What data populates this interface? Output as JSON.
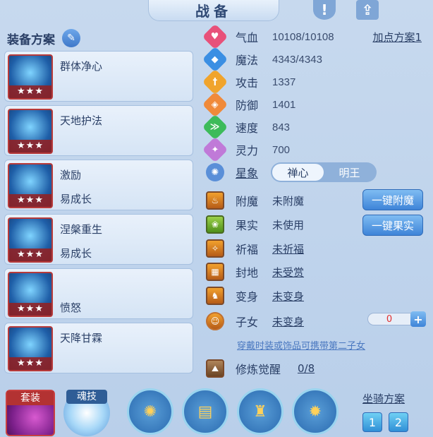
{
  "title": "战备",
  "left": {
    "plan_header": "装备方案",
    "plans": [
      {
        "name": "群体净心",
        "sub": "",
        "stars": "★★★"
      },
      {
        "name": "天地护法",
        "sub": "",
        "stars": "★★★"
      },
      {
        "name": "激励",
        "sub": "易成长",
        "stars": "★★★"
      },
      {
        "name": "涅槃重生",
        "sub": "易成长",
        "stars": "★★★"
      },
      {
        "name": "",
        "sub": "愤怒",
        "stars": "★★★"
      },
      {
        "name": "天降甘霖",
        "sub": "",
        "stars": "★★★"
      }
    ]
  },
  "stats": {
    "add_point_plan": "加点方案1",
    "rows": [
      {
        "label": "气血",
        "value": "10108/10108",
        "icon": "heart-icon",
        "color": "#e8517a"
      },
      {
        "label": "魔法",
        "value": "4343/4343",
        "icon": "mana-icon",
        "color": "#3b8fe3"
      },
      {
        "label": "攻击",
        "value": "1337",
        "icon": "sword-icon",
        "color": "#f0a42c"
      },
      {
        "label": "防御",
        "value": "1401",
        "icon": "shield-icon",
        "color": "#f08a3a"
      },
      {
        "label": "速度",
        "value": "843",
        "icon": "speed-icon",
        "color": "#3dbb5a"
      },
      {
        "label": "灵力",
        "value": "700",
        "icon": "spirit-icon",
        "color": "#c07ad8"
      }
    ],
    "star_label": "星象",
    "toggle": {
      "options": [
        "禅心",
        "明王"
      ],
      "selected": "禅心"
    }
  },
  "props": [
    {
      "label": "附魔",
      "value": "未附魔",
      "underline": false
    },
    {
      "label": "果实",
      "value": "未使用",
      "underline": false
    },
    {
      "label": "祈福",
      "value": "未祈福",
      "underline": true
    },
    {
      "label": "封地",
      "value": "未受赏",
      "underline": true
    },
    {
      "label": "变身",
      "value": "未变身",
      "underline": true
    },
    {
      "label": "子女",
      "value": "未变身",
      "underline": true
    }
  ],
  "buttons": {
    "enchant": "一键附魔",
    "fruit": "一键果实"
  },
  "child_count": "0",
  "hint": "穿戴时装或饰品可携带第二子女",
  "cultivation": {
    "label": "修炼觉醒",
    "value": "0/8"
  },
  "bottom": {
    "skin_tab": "套装",
    "soul_tab": "魂技",
    "mount_title": "坐骑方案",
    "mount_options": [
      "1",
      "2"
    ]
  }
}
